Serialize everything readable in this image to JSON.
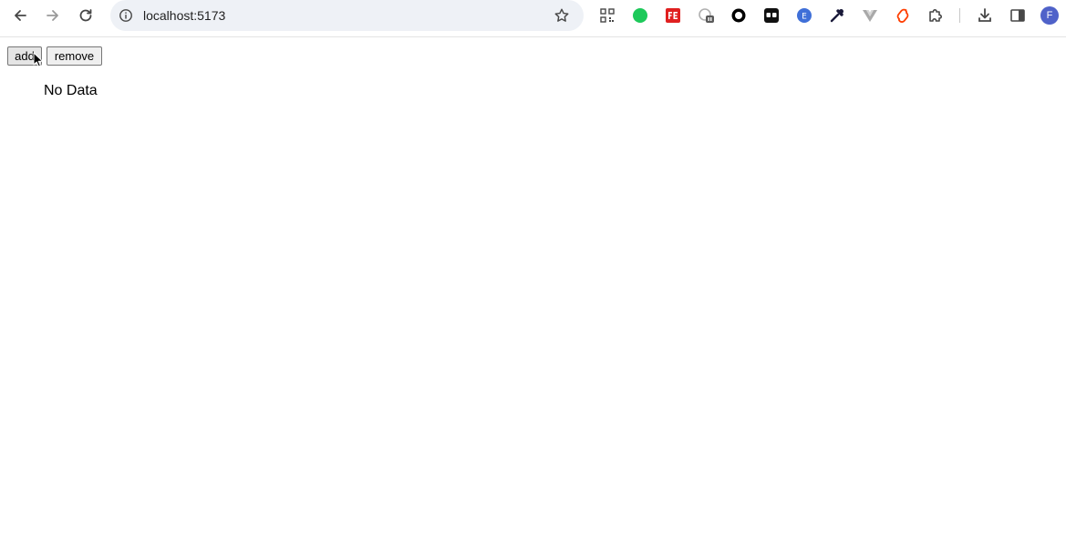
{
  "browser": {
    "address": "localhost:5173",
    "profile_initial": "F",
    "icons": [
      "back-icon",
      "forward-icon",
      "reload-icon",
      "site-info-icon",
      "bookmark-star-icon",
      "qr-code-icon",
      "green-dot-extension-icon",
      "fe-extension-icon",
      "badge-extension-icon",
      "circle-extension-icon",
      "mask-extension-icon",
      "e-extension-icon",
      "eyedropper-extension-icon",
      "vue-extension-icon",
      "svelte-extension-icon",
      "extensions-puzzle-icon",
      "downloads-icon",
      "side-panel-icon"
    ]
  },
  "page": {
    "buttons": {
      "add": "add",
      "remove": "remove"
    },
    "empty_text": "No Data"
  }
}
